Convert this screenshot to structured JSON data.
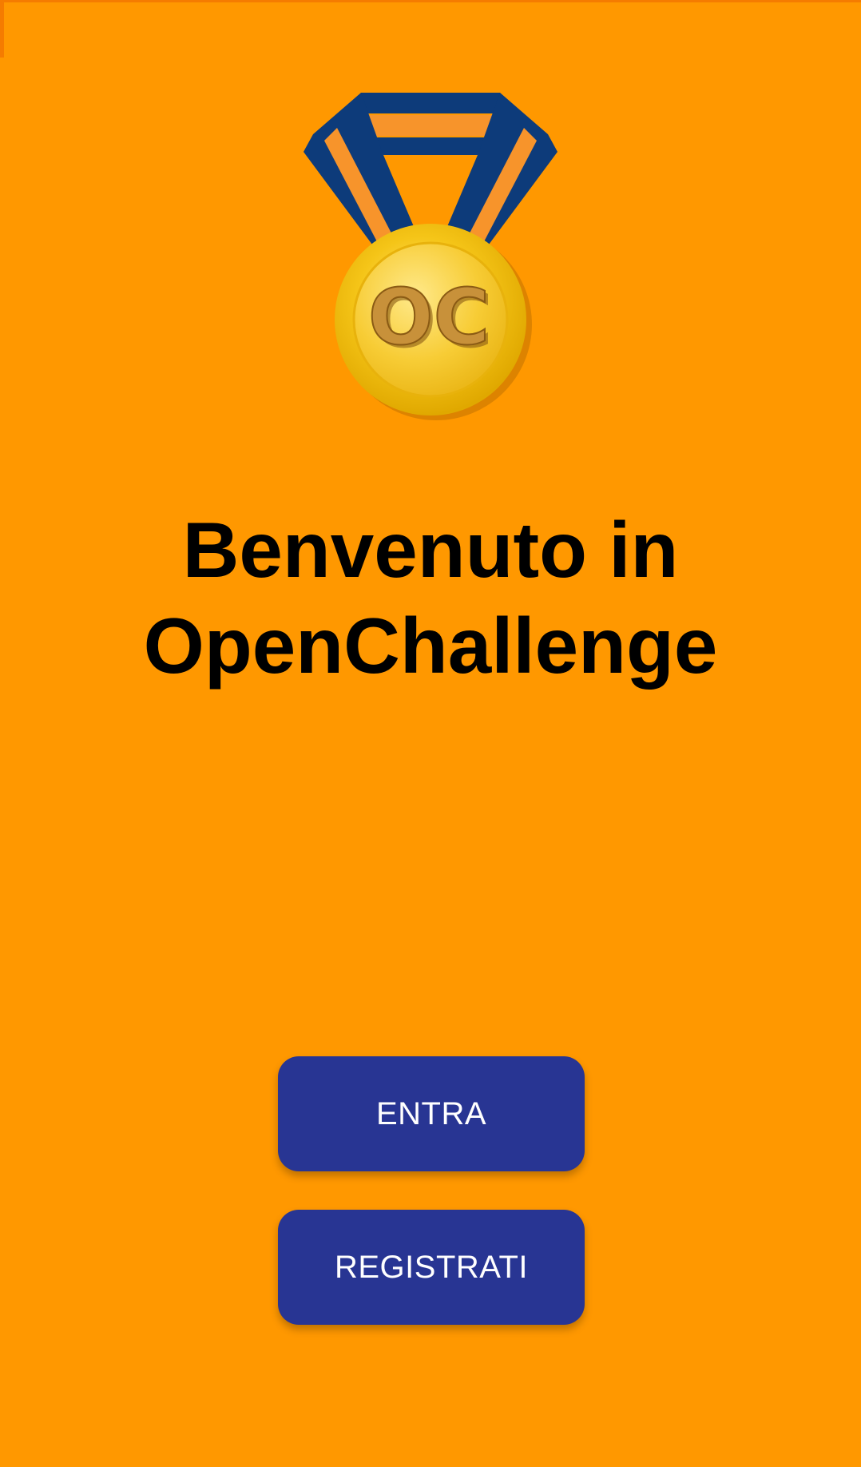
{
  "screen": {
    "background_color": "#ff9800"
  },
  "logo": {
    "icon": "medal-icon",
    "text": "OC",
    "ribbon_blue": "#0d3b7a",
    "ribbon_orange": "#f7942b",
    "medal_gold": "#f5c518"
  },
  "welcome": {
    "line1": "Benvenuto in",
    "line2": "OpenChallenge"
  },
  "buttons": {
    "enter_label": "ENTRA",
    "register_label": "REGISTRATI",
    "color": "#283593"
  }
}
